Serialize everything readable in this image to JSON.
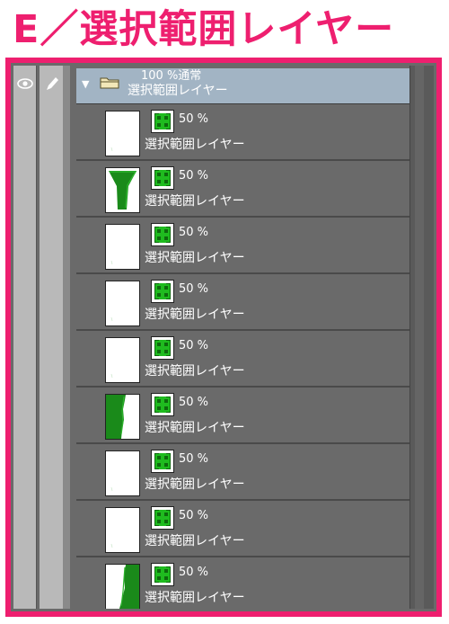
{
  "heading": "E／選択範囲レイヤー",
  "header_icons": {
    "visibility": "eye-icon",
    "lock": "pen-icon"
  },
  "group": {
    "opacity_label": "100 %通常",
    "name": "選択範囲レイヤー",
    "expanded": true
  },
  "layers": [
    {
      "opacity": "50 %",
      "name": "選択範囲レイヤー",
      "thumbnail": "white"
    },
    {
      "opacity": "50 %",
      "name": "選択範囲レイヤー",
      "thumbnail": "green-hourglass"
    },
    {
      "opacity": "50 %",
      "name": "選択範囲レイヤー",
      "thumbnail": "white"
    },
    {
      "opacity": "50 %",
      "name": "選択範囲レイヤー",
      "thumbnail": "white"
    },
    {
      "opacity": "50 %",
      "name": "選択範囲レイヤー",
      "thumbnail": "white"
    },
    {
      "opacity": "50 %",
      "name": "選択範囲レイヤー",
      "thumbnail": "green-left"
    },
    {
      "opacity": "50 %",
      "name": "選択範囲レイヤー",
      "thumbnail": "white"
    },
    {
      "opacity": "50 %",
      "name": "選択範囲レイヤー",
      "thumbnail": "white"
    },
    {
      "opacity": "50 %",
      "name": "選択範囲レイヤー",
      "thumbnail": "green-right"
    }
  ],
  "colors": {
    "accent_border": "#ee1f6f",
    "panel_bg": "#6a6a6a",
    "group_row_bg": "#a2b4c4",
    "mask_green": "#1fbb1f"
  }
}
